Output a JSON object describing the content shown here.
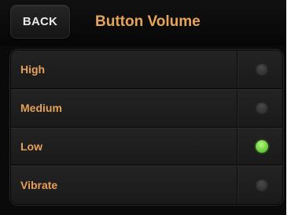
{
  "header": {
    "back_label": "BACK",
    "title": "Button Volume"
  },
  "options": [
    {
      "label": "High",
      "selected": false
    },
    {
      "label": "Medium",
      "selected": false
    },
    {
      "label": "Low",
      "selected": true
    },
    {
      "label": "Vibrate",
      "selected": false
    }
  ],
  "colors": {
    "accent_text": "#e6a05a",
    "selected_indicator": "#6fd13a",
    "unselected_indicator": "#3a3a3a",
    "background": "#0a0a0a"
  }
}
